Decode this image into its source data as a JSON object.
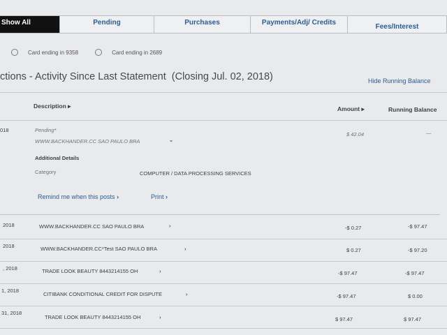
{
  "tabs": [
    {
      "label": "Show All"
    },
    {
      "label": "Pending"
    },
    {
      "label": "Purchases"
    },
    {
      "label": "Payments/Adj/ Credits"
    },
    {
      "label": "Fees/Interest"
    }
  ],
  "cards": [
    {
      "label": "Card ending in 9358"
    },
    {
      "label": "Card ending in 2689"
    }
  ],
  "heading": "ctions - Activity Since Last Statement",
  "closing": "(Closing Jul. 02, 2018)",
  "hide_running_balance": "Hide Running Balance",
  "columns": {
    "description": "Description ▸",
    "amount": "Amount ▸",
    "running_balance": "Running Balance"
  },
  "pending_entry": {
    "date": "018",
    "status": "Pending*",
    "merchant": "WWW.BACKHANDER.CC SAO PAULO BRA",
    "amount": "$ 42.04",
    "balance": "—",
    "details_title": "Additional Details",
    "category_label": "Category",
    "category_value": "COMPUTER / DATA PROCESSING SERVICES",
    "remind_link": "Remind me when this posts",
    "print_link": "Print"
  },
  "rows": [
    {
      "date": "2018",
      "description": "WWW.BACKHANDER.CC SAO PAULO BRA",
      "amount": "-$ 0.27",
      "balance": "-$ 97.47"
    },
    {
      "date": "2018",
      "description": "WWW.BACKHANDER.CC*Test SAO PAULO BRA",
      "amount": "$ 0.27",
      "balance": "-$ 97.20"
    },
    {
      "date": ", 2018",
      "description": "TRADE LOOK BEAUTY 8443214155 OH",
      "amount": "-$ 97.47",
      "balance": "-$ 97.47"
    },
    {
      "date": "1, 2018",
      "description": "CITIBANK CONDITIONAL CREDIT FOR DISPUTE",
      "amount": "-$ 97.47",
      "balance": "$ 0.00"
    },
    {
      "date": "31, 2018",
      "description": "TRADE LOOK BEAUTY 8443214155 OH",
      "amount": "$ 97.47",
      "balance": "$ 97.47"
    }
  ]
}
